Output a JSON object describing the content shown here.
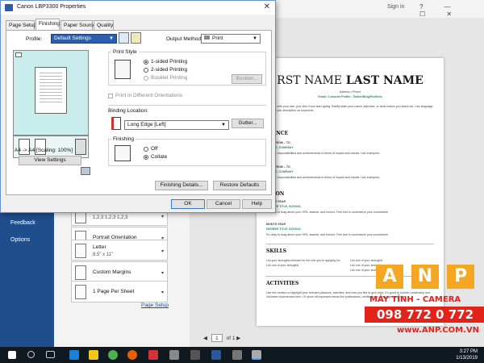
{
  "word": {
    "sign_in": "Sign in",
    "window_controls": "?  —  ☐  ✕",
    "sidebar": {
      "feedback": "Feedback",
      "options": "Options"
    },
    "settings": [
      {
        "line1": "",
        "line2": "1,2,3    1,2,3    1,2,3",
        "icon": "collate-icon"
      },
      {
        "line1": "Portrait Orientation",
        "line2": "",
        "icon": "portrait-icon"
      },
      {
        "line1": "Letter",
        "line2": "8.5\" x 11\"",
        "icon": "paper-size-icon"
      },
      {
        "line1": "Custom Margins",
        "line2": "",
        "icon": "margins-icon"
      },
      {
        "line1": "1 Page Per Sheet",
        "line2": "",
        "icon": "pages-per-sheet-icon"
      }
    ],
    "page_setup": "Page Setup",
    "pager": {
      "current": "1",
      "of": "of 1"
    }
  },
  "resume": {
    "name_light": "RST NAME",
    "name_bold": "LAST NAME",
    "contact": "Address • Phone",
    "links": "Email • LinkedIn Profile • Twitter/Blog/Portfolio",
    "intro": "this text with your own, just click it and start typing. Briefly state your career objective, or what makes you stand out. Use language from the job description as keywords.",
    "sections": [
      "RIENCE",
      "ATION",
      "SKILLS",
      "ACTIVITIES"
    ],
    "experience": [
      {
        "dates": "ATES FROM – TO",
        "title": "B TITLE, COMPANY",
        "desc": "ize your responsibilities and achievements in terms of impact and results. Use examples,"
      },
      {
        "dates": "ATES FROM – TO",
        "title": "B TITLE, COMPANY",
        "desc": "ize your responsibilities and achievements in terms of impact and results. Use examples,"
      }
    ],
    "education": [
      {
        "date": "MONTH YEAR",
        "degree": "DEGREE TITLE, SCHOOL",
        "desc": "It's okay to brag about your GPA, awards, and honors. Feel free to summarize your coursework"
      },
      {
        "date": "MONTH YEAR",
        "degree": "DEGREE TITLE, SCHOOL",
        "desc": "It's okay to brag about your GPA, awards, and honors. Feel free to summarize your coursework"
      }
    ],
    "skills": [
      "List your strengths relevant for the role you're applying for",
      "List one of your strengths",
      "List one of your strengths",
      "List one of your strengths",
      "List one of your strengths"
    ],
    "activities": "Use this section to highlight your relevant passions, activities, and how you like to give back. It's good to include Leadership and volunteer experiences here. Or show off important extras like publications, certifications, languages and more."
  },
  "watermark": {
    "letters": [
      "A",
      "N",
      "P"
    ],
    "tagline": "MÁY TÍNH - CAMERA",
    "phone": "098 772 0 772",
    "web": "www.ANP.COM.VN"
  },
  "dialog": {
    "title": "Canon LBP3300 Properties",
    "tabs": [
      "Page Setup",
      "Finishing",
      "Paper Source",
      "Quality"
    ],
    "active_tab": "Finishing",
    "profile_label": "Profile:",
    "profile_value": "Default Settings",
    "output_label": "Output Method:",
    "output_value": "Print",
    "preview_caption": "A4 -> A4 [Scaling: 100%]",
    "view_settings": "View Settings",
    "print_style": {
      "label": "Print Style",
      "options": [
        "1-sided Printing",
        "2-sided Printing",
        "Booklet Printing"
      ],
      "selected": "1-sided Printing",
      "booklet_button": "Booklet...",
      "different_orientations": "Print in Different Orientations"
    },
    "binding": {
      "label": "Binding Location:",
      "value": "Long Edge [Left]",
      "gutter_button": "Gutter..."
    },
    "finishing": {
      "label": "Finishing",
      "options": [
        "Off",
        "Collate"
      ],
      "selected": "Collate"
    },
    "finishing_details": "Finishing Details...",
    "restore_defaults": "Restore Defaults",
    "ok": "OK",
    "cancel": "Cancel",
    "help": "Help"
  },
  "taskbar": {
    "time": "3:27 PM",
    "date": "1/13/2019",
    "colors": {
      "bar": "#101820",
      "accent": "#1e4e8c"
    }
  }
}
